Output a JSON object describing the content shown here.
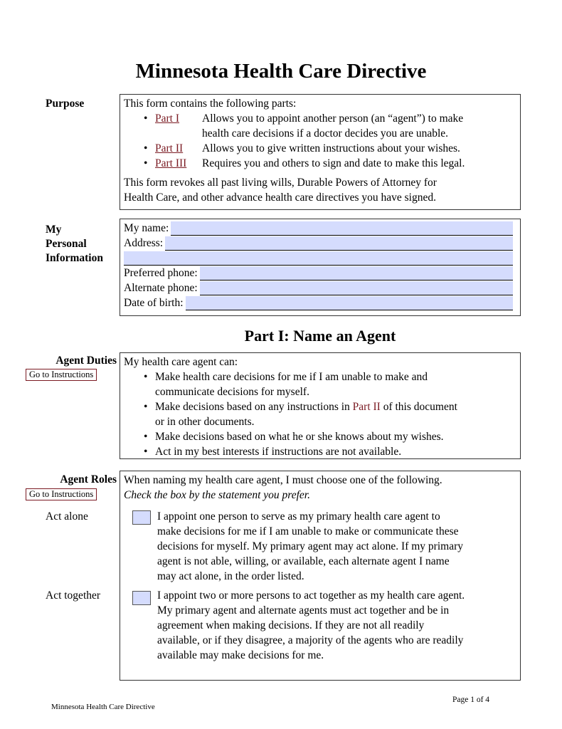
{
  "document": {
    "title": "Minnesota Health Care Directive"
  },
  "purpose": {
    "label": "Purpose",
    "intro": "This form contains the following parts:",
    "parts": [
      {
        "link": "Part I",
        "text": "Allows you to appoint another person (an “agent”) to make",
        "text2": "health care decisions if a doctor decides you are unable."
      },
      {
        "link": "Part II",
        "text": "Allows you to give written instructions about your wishes."
      },
      {
        "link": "Part III",
        "text": "Requires you and others to sign and date to make this legal."
      }
    ],
    "revokes_line1": "This form revokes all past living wills, Durable Powers of Attorney for",
    "revokes_line2": "Health Care, and other advance health care directives you have signed."
  },
  "personal": {
    "label_lines": [
      "My",
      "Personal",
      "Information"
    ],
    "fields": [
      {
        "label": "My name:",
        "value": ""
      },
      {
        "label": "Address:",
        "value": ""
      },
      {
        "label": "",
        "value": ""
      },
      {
        "label": "Preferred phone:",
        "value": ""
      },
      {
        "label": "Alternate phone:",
        "value": ""
      },
      {
        "label": "Date of birth:",
        "value": ""
      }
    ]
  },
  "part1": {
    "heading": "Part I: Name an Agent",
    "duties": {
      "label": "Agent Duties",
      "button": "Go to Instructions",
      "intro": "My health care agent can:",
      "items": [
        {
          "line1": "Make health care decisions for me if I am unable to make and",
          "line2": "communicate decisions for myself."
        },
        {
          "pre": "Make decisions based on any instructions in ",
          "link": "Part II",
          "post": " of this document",
          "line2": "or in other documents."
        },
        {
          "line1": "Make decisions based on what he or she knows about my wishes."
        },
        {
          "line1": "Act in my best interests if instructions are not available."
        }
      ]
    },
    "roles": {
      "label": "Agent Roles",
      "button": "Go to Instructions",
      "intro": "When naming my health care agent, I must choose one of the following.",
      "instruction": "Check the box by the statement you prefer.",
      "options": [
        {
          "label": "Act alone",
          "checked": false,
          "lines": [
            "I appoint one person to serve as my primary health care agent to",
            "make decisions for me if I am unable to make or communicate these",
            "decisions for myself. My primary agent may act alone. If my primary",
            "agent is not able, willing, or available, each alternate agent I name",
            "may act alone, in the order listed."
          ]
        },
        {
          "label": "Act together",
          "checked": false,
          "lines": [
            "I appoint two or more persons to act together as my health care agent.",
            "My primary agent and alternate agents must act together and be in",
            "agreement when making decisions. If they are not all readily",
            "available, or if they disagree, a majority of the agents who are readily",
            "available may make decisions for me."
          ]
        }
      ]
    }
  },
  "footer": {
    "left": "Minnesota Health Care Directive",
    "right": "Page 1 of 4"
  },
  "colors": {
    "link": "#7a1a22",
    "field_fill": "#d5dcfd",
    "border": "#333333"
  }
}
